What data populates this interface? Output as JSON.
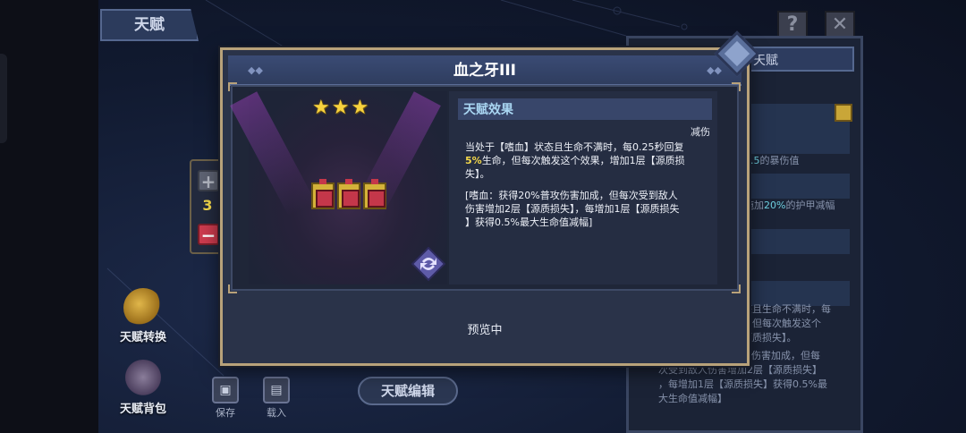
{
  "background": {
    "tab_label": "天赋",
    "help_button": "?",
    "close_button": "✕",
    "right_panel": {
      "header": "天赋",
      "lines": [
        {
          "pre": "",
          "hl": "0.5",
          "post": "的暴伤值"
        },
        {
          "pre": "施加",
          "hl": "20%",
          "post": "的护甲减幅"
        }
      ],
      "paragraph_1": [
        "态且生命不满时，每",
        "，但每次触发这个",
        "原质损失】。"
      ],
      "paragraph_2": [
        "攻击伤害加成，但每",
        "次受到敌人伤害增加2层【源质损失】",
        "，每增加1层【源质损失】获得0.5%最",
        "大生命值减幅】"
      ]
    }
  },
  "side_menu": {
    "talent_switch": "天赋转换",
    "talent_bag": "天赋背包"
  },
  "bottom_bar": {
    "save": "保存",
    "load": "载入",
    "edit": "天赋编辑"
  },
  "stepper": {
    "plus": "+",
    "minus": "−",
    "value": "3"
  },
  "dialog": {
    "title": "血之牙III",
    "stars": "★★★",
    "star_count": 3,
    "relic_count": 3,
    "effect_header": "天赋效果",
    "effect_tag": "减伤",
    "effect_main": {
      "line1": "当处于【嗜血】状态且生命不满时，每0.25秒回复",
      "line2_hl": "5%",
      "line2": "生命，但每次触发这个效果，增加1层【源质损",
      "line3": "失】。"
    },
    "effect_sub": [
      "[嗜血：获得20%普攻伤害加成，但每次受到敌人",
      "伤害增加2层【源质损失】，每增加1层【源质损失",
      "】获得0.5%最大生命值减幅]"
    ],
    "status": "预览中"
  },
  "colors": {
    "gold_border": "#b8a27a",
    "star": "#f7d23e",
    "highlight": "#f4d84a",
    "minus_red": "#cc3b4e"
  }
}
